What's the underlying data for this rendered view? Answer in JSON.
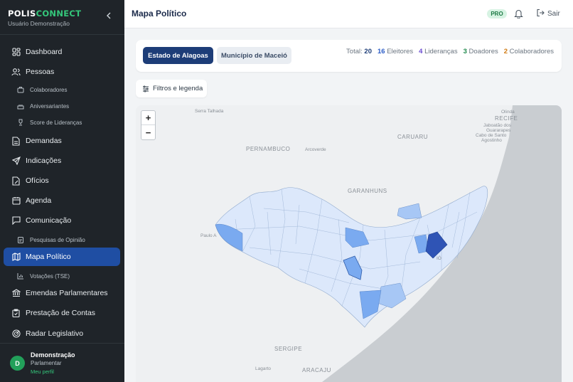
{
  "brand": {
    "part1": "POLIS",
    "part2": "CONNECT",
    "subtitle": "Usuário Demonstração"
  },
  "sidebar": {
    "items": [
      {
        "label": "Dashboard",
        "icon": "dashboard-icon"
      },
      {
        "label": "Pessoas",
        "icon": "people-icon"
      },
      {
        "label": "Colaboradores",
        "icon": "briefcase-icon"
      },
      {
        "label": "Aniversariantes",
        "icon": "cake-icon"
      },
      {
        "label": "Score de Lideranças",
        "icon": "trophy-icon"
      },
      {
        "label": "Demandas",
        "icon": "document-icon"
      },
      {
        "label": "Indicações",
        "icon": "send-icon"
      },
      {
        "label": "Ofícios",
        "icon": "file-edit-icon"
      },
      {
        "label": "Agenda",
        "icon": "calendar-icon"
      },
      {
        "label": "Comunicação",
        "icon": "chat-icon"
      },
      {
        "label": "Pesquisas de Opinião",
        "icon": "clipboard-icon"
      },
      {
        "label": "Mapa Político",
        "icon": "map-icon"
      },
      {
        "label": "Votações (TSE)",
        "icon": "bar-chart-icon"
      },
      {
        "label": "Emendas Parlamentares",
        "icon": "bank-icon"
      },
      {
        "label": "Prestação de Contas",
        "icon": "clipboard-check-icon"
      },
      {
        "label": "Radar Legislativo",
        "icon": "radar-icon"
      }
    ]
  },
  "user": {
    "initial": "D",
    "name": "Demonstração",
    "role": "Parlamentar",
    "profile_link": "Meu perfil"
  },
  "header": {
    "title": "Mapa Político",
    "badge": "PRO",
    "logout": "Sair"
  },
  "tabs": {
    "active": "Estado de Alagoas",
    "inactive": "Município de Maceió"
  },
  "stats": {
    "total_label": "Total:",
    "total": "20",
    "eleitores": "16",
    "eleitores_label": "Eleitores",
    "liderancas": "4",
    "liderancas_label": "Lideranças",
    "doadores": "3",
    "doadores_label": "Doadores",
    "colaboradores": "2",
    "colaboradores_label": "Colaboradores",
    "colors": {
      "total": "#1d3d78",
      "eleitores": "#2b5cc7",
      "liderancas": "#6a4bd1",
      "doadores": "#1f8a4c",
      "colaboradores": "#d07a12"
    }
  },
  "filters": {
    "label": "Filtros e legenda"
  },
  "map": {
    "zoom_in": "+",
    "zoom_out": "−",
    "labels": {
      "serra_talhada": "Serra Talhada",
      "olinda": "Olinda",
      "recife": "RECIFE",
      "jaboatao": "Jaboatão dos",
      "guararapes": "Guararapes",
      "cabo": "Cabo de Santo",
      "agostinho": "Agostinho",
      "caruaru": "CARUARU",
      "pernambuco": "PERNAMBUCO",
      "arcoverde": "Arcoverde",
      "garanhuns": "GARANHUNS",
      "paulo_afonso": "Paulo A",
      "maceio_suffix": "IÓ",
      "sergipe": "SERGIPE",
      "lagarto": "Lagarto",
      "aracaju": "ARACAJU"
    },
    "colors": {
      "base": "#dce8fb",
      "light": "#a7c7f5",
      "medium": "#7aaaf0",
      "dark": "#2f54b5",
      "ocean": "#c9cdd1"
    }
  }
}
